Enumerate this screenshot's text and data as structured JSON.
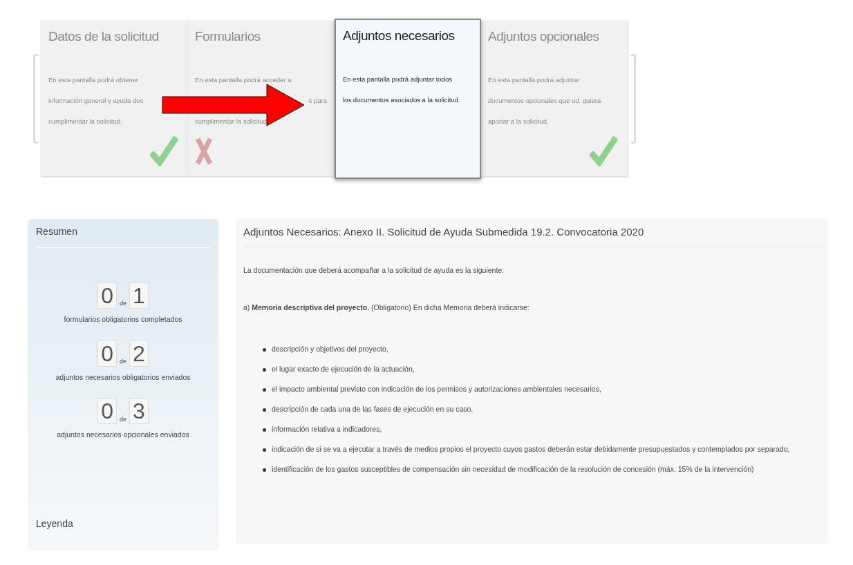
{
  "steps": [
    {
      "title": "Datos de la solicitud",
      "lines": [
        "En esta pantalla podrá obtener",
        "información general y ayuda des",
        "cumplimentar la solicitud."
      ],
      "kind": "done",
      "selected": false
    },
    {
      "title": "Formularios",
      "lines": [
        "En esta pantalla podrá acceder a",
        "s para",
        "cumplimentar la solicitud."
      ],
      "kind": "error",
      "selected": false
    },
    {
      "title": "Adjuntos necesarios",
      "lines": [
        "En esta pantalla podrá adjuntar todos",
        "los documentos asociados a la solicitud."
      ],
      "kind": "plain",
      "selected": true
    },
    {
      "title": "Adjuntos opcionales",
      "lines": [
        "En esta pantalla podrá adjuntar",
        "documentos opcionales que ud. quiera",
        "aportar a la solicitud."
      ],
      "kind": "done",
      "selected": false
    }
  ],
  "summary": {
    "title": "Resumen",
    "counters": [
      {
        "done": "0",
        "of": "de",
        "total": "1",
        "label": "formularios obligatorios completados"
      },
      {
        "done": "0",
        "of": "de",
        "total": "2",
        "label": "adjuntos necesarios obligatorios enviados"
      },
      {
        "done": "0",
        "of": "de",
        "total": "3",
        "label": "adjuntos necesarios opcionales enviados"
      }
    ],
    "legend": "Leyenda"
  },
  "main": {
    "title": "Adjuntos Necesarios: Anexo II. Solicitud de Ayuda Submedida 19.2. Convocatoria 2020",
    "intro": "La documentación que deberá acompañar a la solicitud de ayuda es la siguiente:",
    "section": "a) **Memoria descriptiva del proyecto.** (Obligatorio) En dicha Memoria deberá indicarse:",
    "bullets": [
      "descripción y objetivos del proyecto,",
      "el lugar exacto de ejecución de la actuación,",
      "el impacto ambiental previsto con indicación de los permisos y autorizaciones ambientales necesarios,",
      "descripción de cada una de las fases de ejecución en su caso,",
      "información relativa a indicadores,",
      "indicación de si se va a ejecutar a través de medios propios el proyecto cuyos gastos deberán estar debidamente presupuestados y contemplados por separado,",
      "identificación de los gastos susceptibles de compensación sin necesidad de modificación de la resolución de concesión (máx. 15% de la intervención)"
    ]
  }
}
